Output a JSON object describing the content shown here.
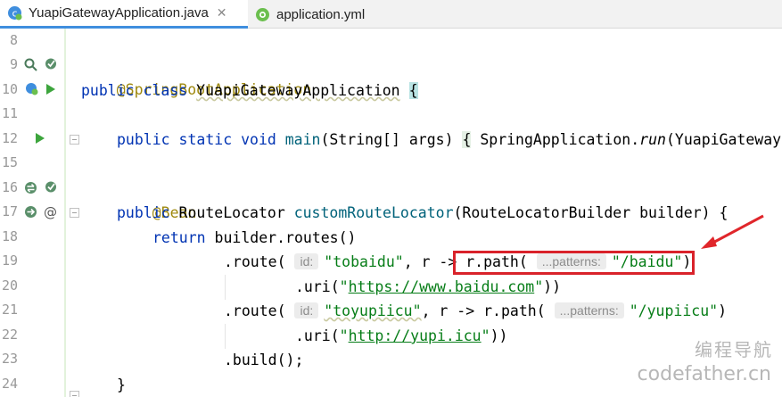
{
  "tabs": [
    {
      "label": "YuapiGatewayApplication.java",
      "close": "✕",
      "active": true
    },
    {
      "label": "application.yml",
      "active": false
    }
  ],
  "line_numbers": [
    "8",
    "9",
    "10",
    "11",
    "12",
    "15",
    "16",
    "17",
    "18",
    "19",
    "20",
    "21",
    "22",
    "23",
    "24"
  ],
  "code": {
    "l9_ann": "@SpringBootApplication",
    "l10_kw": "public class ",
    "l10_name": "YuapiGatewayApplication",
    "l10_brace": "{",
    "l12_kw": "public static void ",
    "l12_fn": "main",
    "l12_args": "(String[] args) ",
    "l12_brace": "{",
    "l12_rest": " SpringApplication.",
    "l12_run": "run",
    "l12_tail": "(YuapiGateway",
    "l16_ann": "@Bean",
    "l17_kw": "public ",
    "l17_type": "RouteLocator ",
    "l17_fn": "customRouteLocator",
    "l17_rest": "(RouteLocatorBuilder builder) {",
    "l18_kw": "return ",
    "l18_rest": "builder.routes()",
    "l19_pre": ".route(",
    "l19_hint": "id:",
    "l19_str": "\"tobaidu\"",
    "l19_mid": ", r -> ",
    "l19_path": "r.path(",
    "l19_hint2": "...patterns:",
    "l19_str2": "\"/baidu\"",
    "l19_end": ")",
    "l20_pre": ".uri(",
    "l20_q1": "\"",
    "l20_link": "https://www.baidu.com",
    "l20_q2": "\"",
    "l20_end": "))",
    "l21_pre": ".route(",
    "l21_hint": "id:",
    "l21_str": "\"toyupiicu\"",
    "l21_mid": ", r -> r.path(",
    "l21_hint2": "...patterns:",
    "l21_str2": "\"/yupiicu\"",
    "l21_end": ")",
    "l22_pre": ".uri(",
    "l22_q1": "\"",
    "l22_link": "http://yupi.icu",
    "l22_q2": "\"",
    "l22_end": "))",
    "l23": ".build();",
    "l24": "}"
  },
  "gutter_icons": {
    "l9": [
      "zoom-icon",
      "bean-check-icon"
    ],
    "l10": [
      "spring-run-icon",
      "run-icon"
    ],
    "l12": [
      "run-icon"
    ],
    "l16": [
      "bean-swap-icon",
      "bean-check-icon"
    ],
    "l17": [
      "bean-nav-icon",
      "at-icon"
    ]
  },
  "at_glyph": "@",
  "watermark": {
    "line1": "编程导航",
    "line2": "codefather.cn"
  },
  "colors": {
    "keyword": "#0033b3",
    "annotation": "#9e880d",
    "string": "#067d17",
    "highlight_box": "#d9222a",
    "arrow": "#e0262b",
    "run": "#3da53d"
  }
}
